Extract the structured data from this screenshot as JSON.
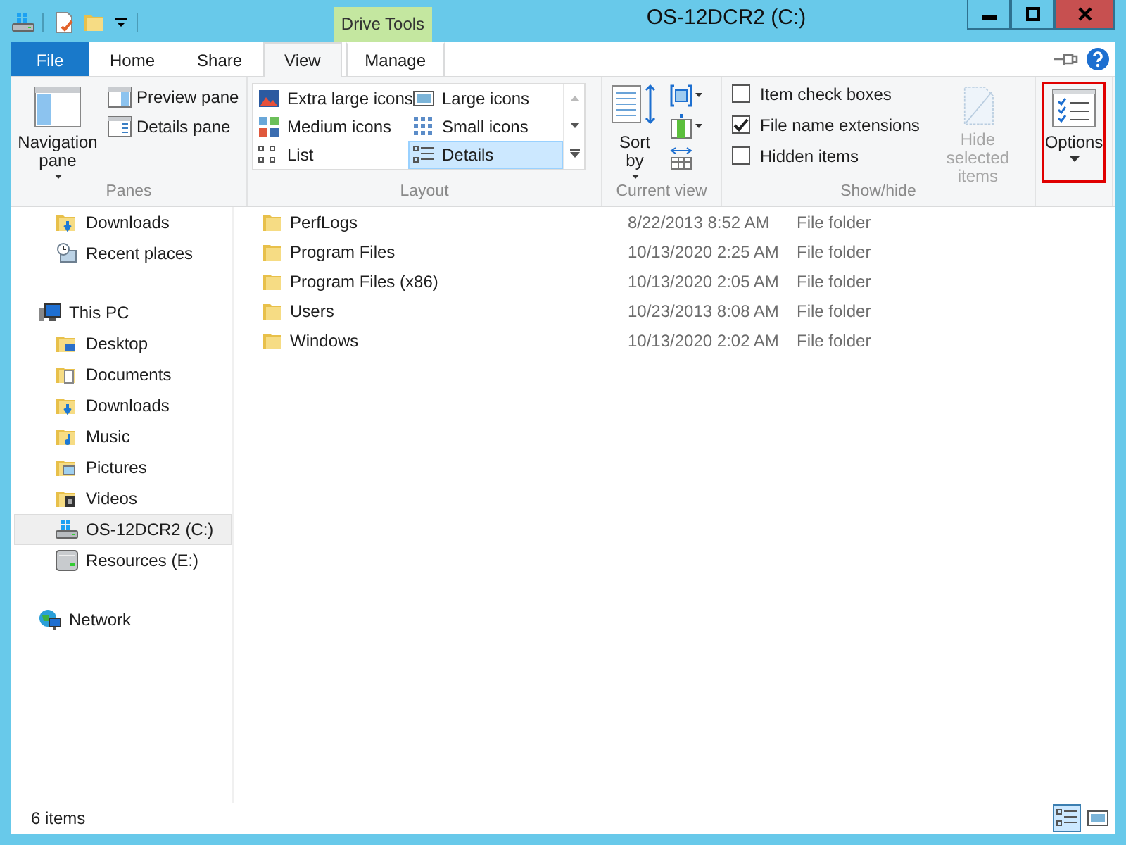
{
  "window": {
    "title": "OS-12DCR2 (C:)",
    "context_label": "Drive Tools"
  },
  "tabs": [
    {
      "label": "File",
      "kind": "file",
      "selected": false
    },
    {
      "label": "Home",
      "kind": "plain",
      "selected": false
    },
    {
      "label": "Share",
      "kind": "plain",
      "selected": false
    },
    {
      "label": "View",
      "kind": "plain",
      "selected": true
    },
    {
      "label": "Manage",
      "kind": "context",
      "selected": false
    }
  ],
  "ribbon": {
    "panes": {
      "label": "Panes",
      "navigation": "Navigation pane",
      "preview": "Preview pane",
      "details": "Details pane"
    },
    "layout": {
      "label": "Layout",
      "items": [
        {
          "label": "Extra large icons",
          "kind": "xl",
          "selected": false
        },
        {
          "label": "Large icons",
          "kind": "large",
          "selected": false
        },
        {
          "label": "Medium icons",
          "kind": "medium",
          "selected": false
        },
        {
          "label": "Small icons",
          "kind": "small",
          "selected": false
        },
        {
          "label": "List",
          "kind": "list",
          "selected": false
        },
        {
          "label": "Details",
          "kind": "details",
          "selected": true
        }
      ]
    },
    "current_view": {
      "label": "Current view",
      "sort": "Sort by"
    },
    "show_hide": {
      "label": "Show/hide",
      "checkboxes": [
        {
          "label": "Item check boxes",
          "checked": false
        },
        {
          "label": "File name extensions",
          "checked": true
        },
        {
          "label": "Hidden items",
          "checked": false
        }
      ],
      "hide_selected": {
        "label": "Hide selected items",
        "disabled": true
      }
    },
    "options": {
      "label": "Options",
      "highlighted": true
    }
  },
  "nav": {
    "scrolled_children": [
      {
        "label": "Downloads",
        "kind": "download",
        "selected": false
      },
      {
        "label": "Recent places",
        "kind": "recent",
        "selected": false
      }
    ],
    "roots": [
      {
        "label": "This PC",
        "kind": "pc",
        "selected": false,
        "children": [
          {
            "label": "Desktop",
            "kind": "desktop",
            "selected": false
          },
          {
            "label": "Documents",
            "kind": "documents",
            "selected": false
          },
          {
            "label": "Downloads",
            "kind": "download",
            "selected": false
          },
          {
            "label": "Music",
            "kind": "music",
            "selected": false
          },
          {
            "label": "Pictures",
            "kind": "pictures",
            "selected": false
          },
          {
            "label": "Videos",
            "kind": "videos",
            "selected": false
          },
          {
            "label": "OS-12DCR2 (C:)",
            "kind": "windrive",
            "selected": true
          },
          {
            "label": "Resources (E:)",
            "kind": "drive",
            "selected": false
          }
        ]
      },
      {
        "label": "Network",
        "kind": "network",
        "selected": false
      }
    ]
  },
  "files": [
    {
      "name": "PerfLogs",
      "date": "8/22/2013 8:52 AM",
      "type": "File folder"
    },
    {
      "name": "Program Files",
      "date": "10/13/2020 2:25 AM",
      "type": "File folder"
    },
    {
      "name": "Program Files (x86)",
      "date": "10/13/2020 2:05 AM",
      "type": "File folder"
    },
    {
      "name": "Users",
      "date": "10/23/2013 8:08 AM",
      "type": "File folder"
    },
    {
      "name": "Windows",
      "date": "10/13/2020 2:02 AM",
      "type": "File folder"
    }
  ],
  "status_bar": {
    "count": "6 items",
    "views": [
      {
        "kind": "details",
        "selected": true
      },
      {
        "kind": "large",
        "selected": false
      }
    ]
  }
}
